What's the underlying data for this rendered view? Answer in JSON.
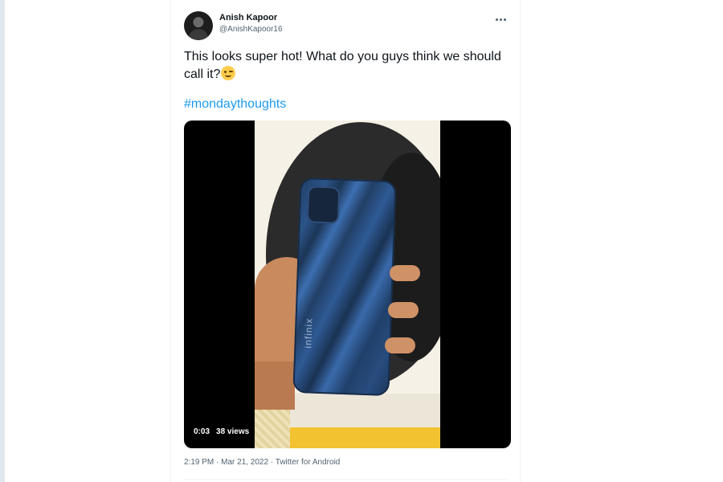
{
  "tweet": {
    "author_name": "Anish Kapoor",
    "author_handle": "@AnishKapoor16",
    "text": "This looks super hot! What do you guys think we should call it?",
    "emoji": "winking-face",
    "hashtag": "#mondaythoughts",
    "video": {
      "duration": "0:03",
      "views": "38 views"
    },
    "timestamp": "2:19 PM · Mar 21, 2022 · Twitter for Android",
    "phone_brand_text": "infinix"
  },
  "colors": {
    "link": "#1d9bf0",
    "text": "#0f1419",
    "secondary": "#536471"
  },
  "icons": {
    "more": "more-horizontal-icon",
    "avatar": "avatar"
  }
}
